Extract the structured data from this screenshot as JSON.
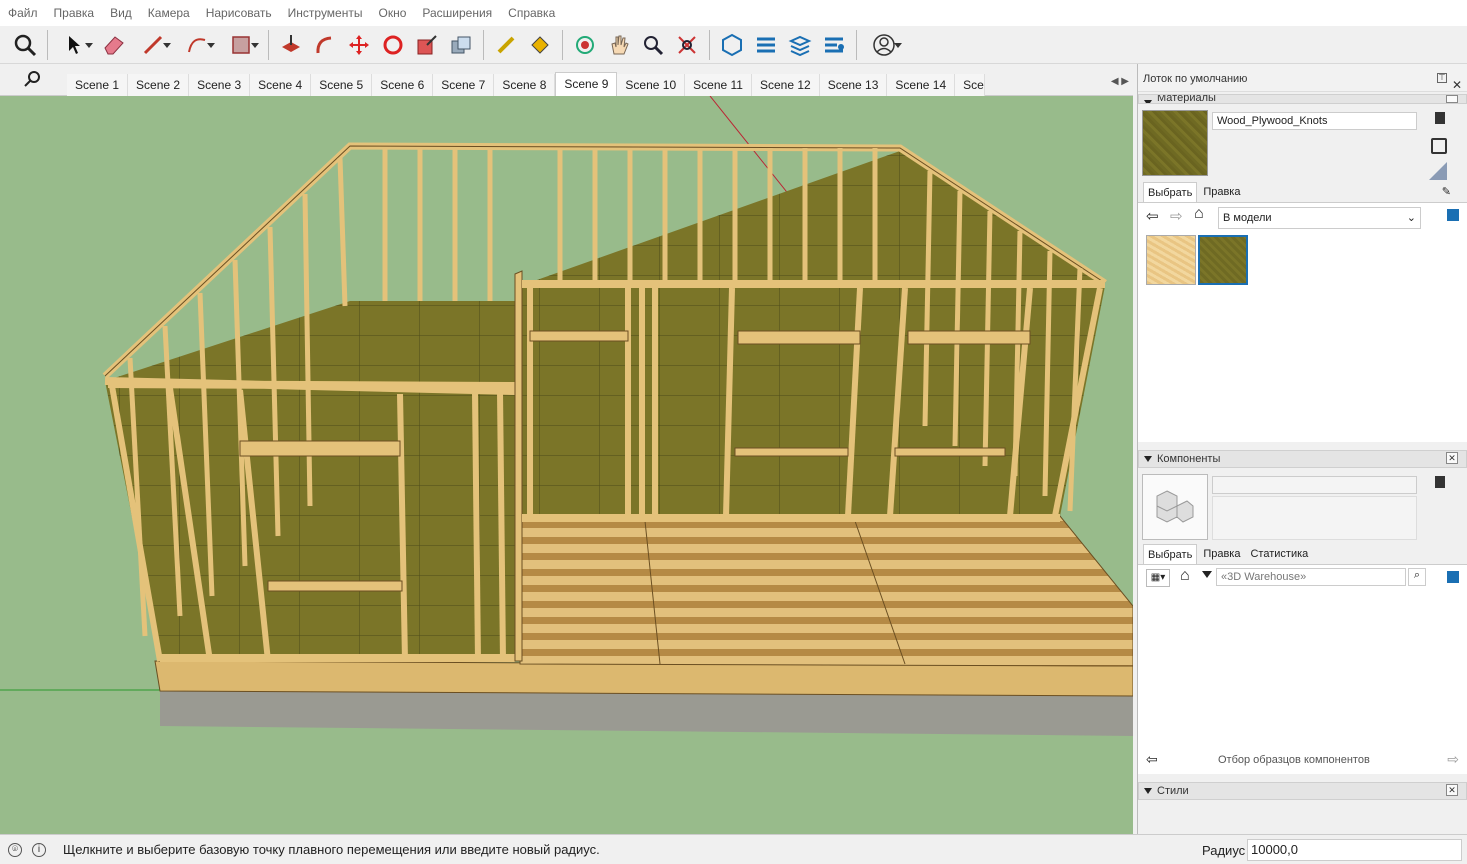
{
  "menu": [
    "Файл",
    "Правка",
    "Вид",
    "Камера",
    "Нарисовать",
    "Инструменты",
    "Окно",
    "Расширения",
    "Справка"
  ],
  "scenes": {
    "tabs": [
      "Scene 1",
      "Scene 2",
      "Scene 3",
      "Scene 4",
      "Scene 5",
      "Scene 6",
      "Scene 7",
      "Scene 8",
      "Scene 9",
      "Scene 10",
      "Scene 11",
      "Scene 12",
      "Scene 13",
      "Scene 14",
      "Scen"
    ],
    "active_index": 8
  },
  "tray": {
    "title": "Лоток по умолчанию",
    "materials": {
      "header": "Материалы",
      "current_name": "Wood_Plywood_Knots",
      "tab_select": "Выбрать",
      "tab_edit": "Правка",
      "collection": "В модели"
    },
    "components": {
      "header": "Компоненты",
      "tab_select": "Выбрать",
      "tab_edit": "Правка",
      "tab_stats": "Статистика",
      "search_placeholder": "«3D Warehouse»",
      "footer": "Отбор образцов компонентов"
    },
    "styles": {
      "header": "Стили"
    }
  },
  "status": {
    "hint": "Щелкните и выберите базовую точку плавного перемещения или введите новый радиус.",
    "radius_label": "Радиус",
    "radius_value": "10000,0"
  },
  "colors": {
    "viewport": "#98bb8b",
    "wood": "#e5c27a",
    "plywood": "#7b7528",
    "foundation": "#9a9a92"
  }
}
